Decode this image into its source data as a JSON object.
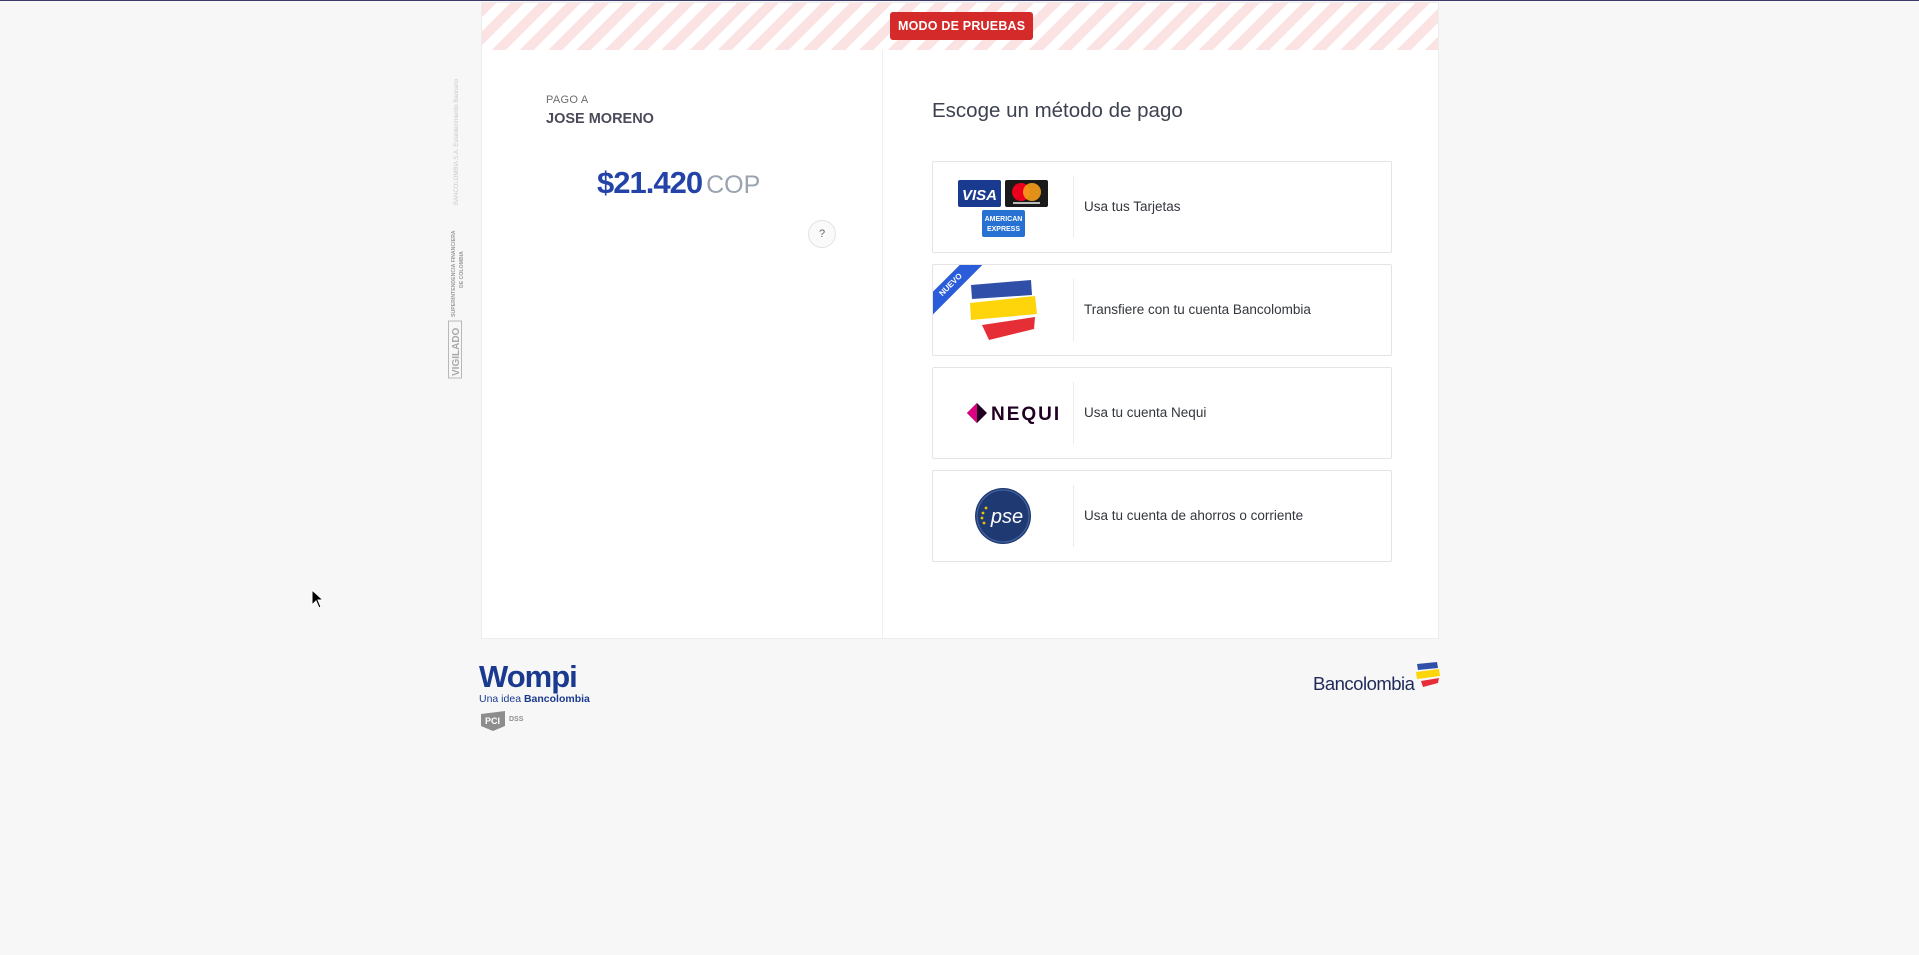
{
  "banner": {
    "text": "MODO DE PRUEBAS",
    "color": "#d42a2a"
  },
  "payee": {
    "label": "PAGO A",
    "name": "JOSE MORENO"
  },
  "amount": {
    "value": "$21.420",
    "currency": "COP",
    "help": "?"
  },
  "methods": {
    "title": "Escoge un método de pago",
    "items": [
      {
        "label": "Usa tus Tarjetas",
        "icons": [
          "visa-icon",
          "mastercard-icon",
          "amex-icon"
        ]
      },
      {
        "label": "Transfiere con tu cuenta Bancolombia",
        "ribbon": "NUEVO",
        "icons": [
          "bancolombia-icon"
        ]
      },
      {
        "label": "Usa tu cuenta Nequi",
        "icons": [
          "nequi-icon"
        ]
      },
      {
        "label": "Usa tu cuenta de ahorros o corriente",
        "icons": [
          "pse-icon"
        ]
      }
    ]
  },
  "vigilado": {
    "word": "VIGILADO",
    "entity": "SUPERINTENDENCIA FINANCIERA",
    "country": "DE COLOMBIA",
    "bank": "BANCOLOMBIA S.A. Establecimiento Bancario"
  },
  "footer": {
    "wompi": {
      "name": "Wompi",
      "tagline_prefix": "Una idea",
      "tagline_brand": "Bancolombia"
    },
    "pci": {
      "left": "PCI",
      "right": "DSS"
    },
    "bancolombia": "Bancolombia"
  },
  "colors": {
    "brand_blue": "#2343a8",
    "wompi_blue": "#1a3a8f",
    "badge_red": "#d42a2a"
  }
}
